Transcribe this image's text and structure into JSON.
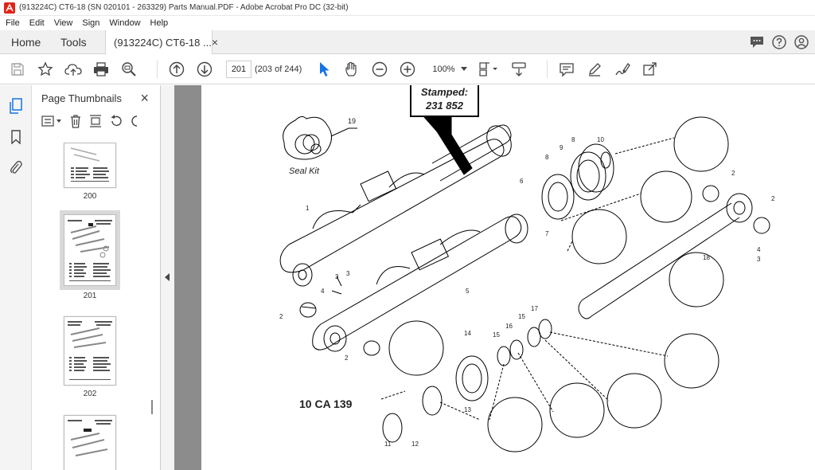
{
  "window": {
    "title": "(913224C) CT6-18 (SN 020101 - 263329) Parts Manual.PDF - Adobe Acrobat Pro DC (32-bit)"
  },
  "menu": [
    "File",
    "Edit",
    "View",
    "Sign",
    "Window",
    "Help"
  ],
  "tabs": {
    "home": "Home",
    "tools": "Tools",
    "document": "(913224C) CT6-18 ...",
    "close": "×"
  },
  "toolbar": {
    "page_number": "201",
    "page_count": "(203 of 244)",
    "zoom": "100%"
  },
  "thumbnail_panel": {
    "title": "Page Thumbnails",
    "close": "×",
    "thumbnails": [
      {
        "label": "200"
      },
      {
        "label": "201",
        "selected": true
      },
      {
        "label": "202"
      }
    ]
  },
  "document": {
    "stamped_line1": "Stamped:",
    "stamped_line2": "231 852",
    "seal_kit": "Seal Kit",
    "ref_code": "10 CA 139",
    "callouts": [
      "19",
      "1",
      "2",
      "3",
      "4",
      "5",
      "6",
      "7",
      "8",
      "9",
      "10",
      "2",
      "2",
      "4",
      "3",
      "18",
      "2",
      "3",
      "14",
      "15",
      "16",
      "15",
      "17",
      "13",
      "11",
      "12",
      "8"
    ]
  },
  "colors": {
    "accent": "#1473e6",
    "app_red": "#e2231a",
    "chrome_bg": "#f0f0f0"
  }
}
